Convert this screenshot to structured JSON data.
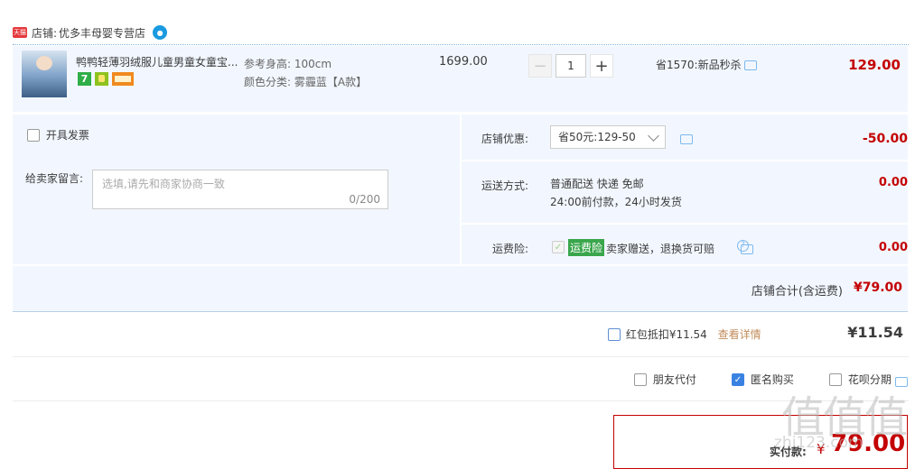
{
  "shop": {
    "badge": "天猫",
    "label": "店铺:",
    "name": "优多丰母婴专营店",
    "chat_icon": "wangwang-icon"
  },
  "item": {
    "title": "鸭鸭轻薄羽绒服儿童男童女童宝...",
    "service_badges": [
      "7",
      "green-service-icon",
      "card-icon"
    ],
    "height_label": "参考身高:",
    "height_value": "100cm",
    "color_label": "颜色分类:",
    "color_value": "雾霾蓝【A款】",
    "original_price": "1699.00",
    "quantity": "1",
    "promo": "省1570:新品秒杀",
    "total": "129.00"
  },
  "invoice_label": "开具发票",
  "message": {
    "label": "给卖家留言:",
    "placeholder": "选填,请先和商家协商一致",
    "count": "0/200"
  },
  "discount": {
    "label": "店铺优惠:",
    "selected": "省50元:129-50",
    "amount": "-50.00"
  },
  "shipping": {
    "label": "运送方式:",
    "line1": "普通配送 快递 免邮",
    "line2": "24:00前付款，24小时发货",
    "amount": "0.00"
  },
  "insurance": {
    "label": "运费险:",
    "tag": "运费险",
    "desc": "卖家赠送，退换货可赔",
    "amount": "0.00"
  },
  "shop_total": {
    "label": "店铺合计(含运费)",
    "amount": "¥79.00"
  },
  "redpacket": {
    "label": "红包抵扣¥11.54",
    "link": "查看详情",
    "amount": "¥11.54"
  },
  "options": [
    {
      "label": "朋友代付",
      "checked": false
    },
    {
      "label": "匿名购买",
      "checked": true
    },
    {
      "label": "花呗分期",
      "checked": false
    }
  ],
  "final": {
    "label": "实付款:",
    "currency": "¥",
    "amount": "79.00"
  },
  "watermark": {
    "top": "值值值",
    "bottom": "zhi123.com"
  }
}
